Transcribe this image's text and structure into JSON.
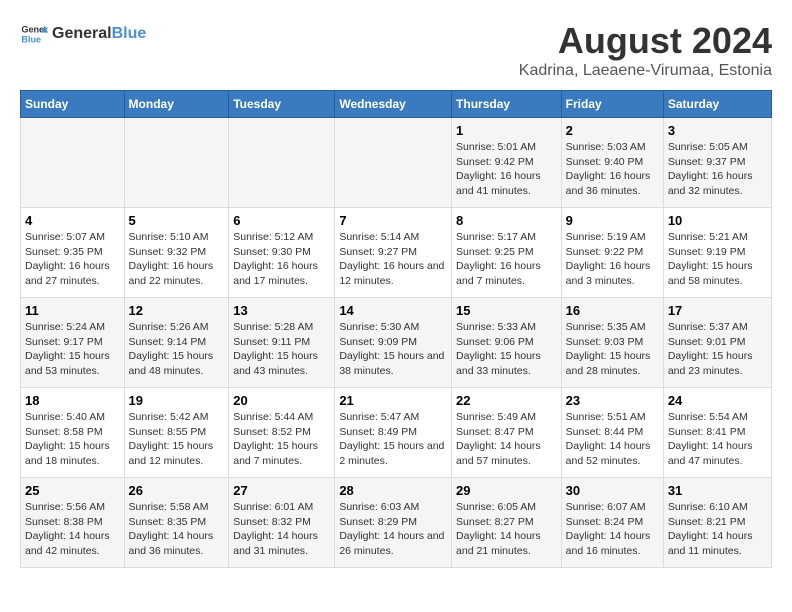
{
  "logo": {
    "general": "General",
    "blue": "Blue"
  },
  "title": "August 2024",
  "subtitle": "Kadrina, Laeaene-Virumaa, Estonia",
  "days_of_week": [
    "Sunday",
    "Monday",
    "Tuesday",
    "Wednesday",
    "Thursday",
    "Friday",
    "Saturday"
  ],
  "weeks": [
    [
      {
        "day": "",
        "info": ""
      },
      {
        "day": "",
        "info": ""
      },
      {
        "day": "",
        "info": ""
      },
      {
        "day": "",
        "info": ""
      },
      {
        "day": "1",
        "info": "Sunrise: 5:01 AM\nSunset: 9:42 PM\nDaylight: 16 hours and 41 minutes."
      },
      {
        "day": "2",
        "info": "Sunrise: 5:03 AM\nSunset: 9:40 PM\nDaylight: 16 hours and 36 minutes."
      },
      {
        "day": "3",
        "info": "Sunrise: 5:05 AM\nSunset: 9:37 PM\nDaylight: 16 hours and 32 minutes."
      }
    ],
    [
      {
        "day": "4",
        "info": "Sunrise: 5:07 AM\nSunset: 9:35 PM\nDaylight: 16 hours and 27 minutes."
      },
      {
        "day": "5",
        "info": "Sunrise: 5:10 AM\nSunset: 9:32 PM\nDaylight: 16 hours and 22 minutes."
      },
      {
        "day": "6",
        "info": "Sunrise: 5:12 AM\nSunset: 9:30 PM\nDaylight: 16 hours and 17 minutes."
      },
      {
        "day": "7",
        "info": "Sunrise: 5:14 AM\nSunset: 9:27 PM\nDaylight: 16 hours and 12 minutes."
      },
      {
        "day": "8",
        "info": "Sunrise: 5:17 AM\nSunset: 9:25 PM\nDaylight: 16 hours and 7 minutes."
      },
      {
        "day": "9",
        "info": "Sunrise: 5:19 AM\nSunset: 9:22 PM\nDaylight: 16 hours and 3 minutes."
      },
      {
        "day": "10",
        "info": "Sunrise: 5:21 AM\nSunset: 9:19 PM\nDaylight: 15 hours and 58 minutes."
      }
    ],
    [
      {
        "day": "11",
        "info": "Sunrise: 5:24 AM\nSunset: 9:17 PM\nDaylight: 15 hours and 53 minutes."
      },
      {
        "day": "12",
        "info": "Sunrise: 5:26 AM\nSunset: 9:14 PM\nDaylight: 15 hours and 48 minutes."
      },
      {
        "day": "13",
        "info": "Sunrise: 5:28 AM\nSunset: 9:11 PM\nDaylight: 15 hours and 43 minutes."
      },
      {
        "day": "14",
        "info": "Sunrise: 5:30 AM\nSunset: 9:09 PM\nDaylight: 15 hours and 38 minutes."
      },
      {
        "day": "15",
        "info": "Sunrise: 5:33 AM\nSunset: 9:06 PM\nDaylight: 15 hours and 33 minutes."
      },
      {
        "day": "16",
        "info": "Sunrise: 5:35 AM\nSunset: 9:03 PM\nDaylight: 15 hours and 28 minutes."
      },
      {
        "day": "17",
        "info": "Sunrise: 5:37 AM\nSunset: 9:01 PM\nDaylight: 15 hours and 23 minutes."
      }
    ],
    [
      {
        "day": "18",
        "info": "Sunrise: 5:40 AM\nSunset: 8:58 PM\nDaylight: 15 hours and 18 minutes."
      },
      {
        "day": "19",
        "info": "Sunrise: 5:42 AM\nSunset: 8:55 PM\nDaylight: 15 hours and 12 minutes."
      },
      {
        "day": "20",
        "info": "Sunrise: 5:44 AM\nSunset: 8:52 PM\nDaylight: 15 hours and 7 minutes."
      },
      {
        "day": "21",
        "info": "Sunrise: 5:47 AM\nSunset: 8:49 PM\nDaylight: 15 hours and 2 minutes."
      },
      {
        "day": "22",
        "info": "Sunrise: 5:49 AM\nSunset: 8:47 PM\nDaylight: 14 hours and 57 minutes."
      },
      {
        "day": "23",
        "info": "Sunrise: 5:51 AM\nSunset: 8:44 PM\nDaylight: 14 hours and 52 minutes."
      },
      {
        "day": "24",
        "info": "Sunrise: 5:54 AM\nSunset: 8:41 PM\nDaylight: 14 hours and 47 minutes."
      }
    ],
    [
      {
        "day": "25",
        "info": "Sunrise: 5:56 AM\nSunset: 8:38 PM\nDaylight: 14 hours and 42 minutes."
      },
      {
        "day": "26",
        "info": "Sunrise: 5:58 AM\nSunset: 8:35 PM\nDaylight: 14 hours and 36 minutes."
      },
      {
        "day": "27",
        "info": "Sunrise: 6:01 AM\nSunset: 8:32 PM\nDaylight: 14 hours and 31 minutes."
      },
      {
        "day": "28",
        "info": "Sunrise: 6:03 AM\nSunset: 8:29 PM\nDaylight: 14 hours and 26 minutes."
      },
      {
        "day": "29",
        "info": "Sunrise: 6:05 AM\nSunset: 8:27 PM\nDaylight: 14 hours and 21 minutes."
      },
      {
        "day": "30",
        "info": "Sunrise: 6:07 AM\nSunset: 8:24 PM\nDaylight: 14 hours and 16 minutes."
      },
      {
        "day": "31",
        "info": "Sunrise: 6:10 AM\nSunset: 8:21 PM\nDaylight: 14 hours and 11 minutes."
      }
    ]
  ]
}
